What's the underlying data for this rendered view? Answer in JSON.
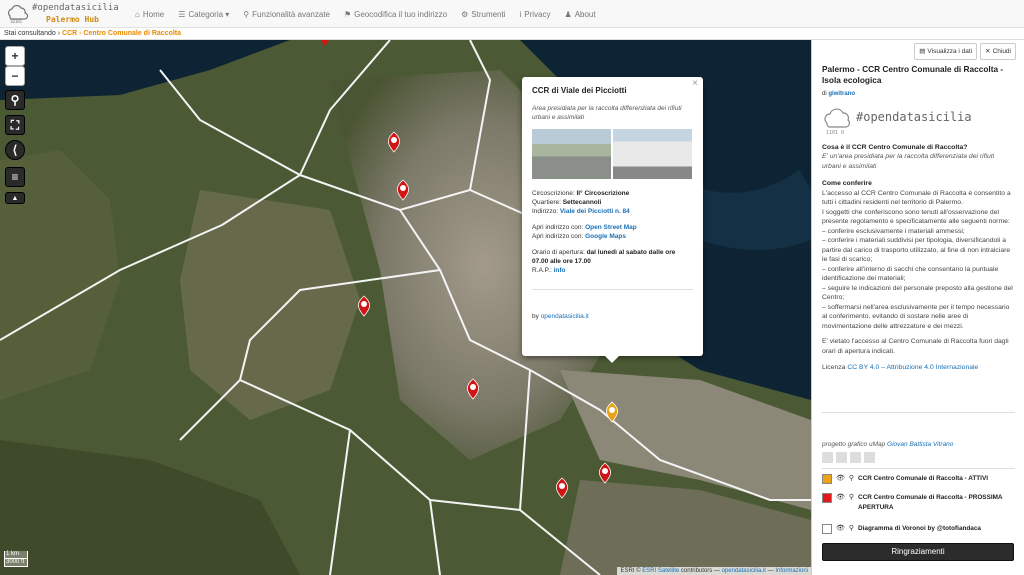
{
  "brand": {
    "line1": "#opendatasicilia",
    "line2": "Palermo Hub"
  },
  "nav": [
    {
      "icon": "home-icon",
      "glyph": "⌂",
      "label": "Home"
    },
    {
      "icon": "list-icon",
      "glyph": "☰",
      "label": "Categoria ▾"
    },
    {
      "icon": "search-icon",
      "glyph": "⚲",
      "label": "Funzionalità avanzate"
    },
    {
      "icon": "map-marker-icon",
      "glyph": "⚑",
      "label": "Geocodifica il tuo indirizzo"
    },
    {
      "icon": "gear-icon",
      "glyph": "⚙",
      "label": "Strumenti"
    },
    {
      "icon": "info-icon",
      "glyph": "i",
      "label": "Privacy"
    },
    {
      "icon": "users-icon",
      "glyph": "♟",
      "label": "About"
    }
  ],
  "breadcrumb": {
    "prefix": "Stai consultando",
    "current": "CCR - Centro Comunale di Raccolta"
  },
  "map_controls": {
    "zoom_in": "+",
    "zoom_out": "−"
  },
  "popup": {
    "close": "×",
    "title": "CCR di Viale dei Picciotti",
    "description": "Area presidiata per la raccolta differenziata dei rifiuti urbani e assimilati",
    "circoscrizione_label": "Circoscrizione:",
    "circoscrizione": "II° Circoscrizione",
    "quartiere_label": "Quartiere:",
    "quartiere": "Settecannoli",
    "indirizzo_label": "Indirizzo:",
    "indirizzo": "Viale dei Picciotti n. 84",
    "osm_label": "Apri indirizzo con:",
    "osm_link": "Open Street Map",
    "gmaps_label": "Apri indirizzo con:",
    "gmaps_link": "Google Maps",
    "orario_label": "Orario di apertura:",
    "orario": "dal lunedì al sabato dalle ore 07.00 alle ore 17.00",
    "rap_label": "R.A.P.:",
    "rap_link": "info",
    "by_label": "by",
    "by_link": "opendatasicilia.it"
  },
  "scale": {
    "km": "1 km",
    "ft": "3000 ft"
  },
  "attribution": {
    "prefix": "ESRI ©",
    "link1": "ESRI Satellite",
    "middle": "contributors —",
    "link2": "opendatasicilia.it",
    "suffix": "—",
    "link3": "Informazioni"
  },
  "sidebar": {
    "btn_data": "Visualizza i dati",
    "btn_close": "Chiudi",
    "title": "Palermo - CCR Centro Comunale di Raccolta - Isola ecologica",
    "by_prefix": "di",
    "by_author": "giwitrano",
    "logo_text": "#opendatasicilia",
    "question": "Cosa è il CCR Centro Comunale di Raccolta?",
    "answer": "E' un'area presidiata per la raccolta differenziata dei rifiuti urbani e assimilati",
    "how_title": "Come conferire",
    "how_text": "L'accesso al CCR Centro Comunale di Raccolta è consentito a tutti i cittadini residenti nel territorio di Palermo.",
    "rules_intro": "I soggetti che conferiscono sono tenuti all'osservazione del presente regolamento e specificatamente alle seguenti norme:",
    "rules": [
      "– conferire esclusivamente i materiali ammessi;",
      "– conferire i materiali suddivisi per tipologia, diversificandoli a partire dal carico di trasporto utilizzato, al fine di non intralciare le fasi di scarico;",
      "– conferire all'interno di sacchi che consentano la puntuale identificazione dei materiali;",
      "– seguire le indicazioni del personale preposto alla gestione del Centro;",
      "– soffermarsi nell'area esclusivamente per il tempo necessario al conferimento, evitando di sostare nelle aree di movimentazione delle attrezzature e dei mezzi."
    ],
    "forbidden": "E' vietato l'accesso al Centro Comunale di Raccolta fuori dagli orari di apertura indicati.",
    "license_prefix": "Licenza",
    "license_link": "CC BY 4.0 – Attribuzione 4.0 Internazionale",
    "project_prefix": "progetto grafico uMap",
    "project_author": "Giovan Battista Vitrano",
    "legend": [
      {
        "label": "CCR Centro Comunale di Raccolta - ATTIVI",
        "color": "#e8a317"
      },
      {
        "label": "CCR Centro Comunale di Raccolta - PROSSIMA APERTURA",
        "color": "#e01a1a"
      },
      {
        "label": "Diagramma di Voronoi by @totofiandaca",
        "color": "#ffffff"
      }
    ],
    "thanks": "Ringraziamenti"
  }
}
